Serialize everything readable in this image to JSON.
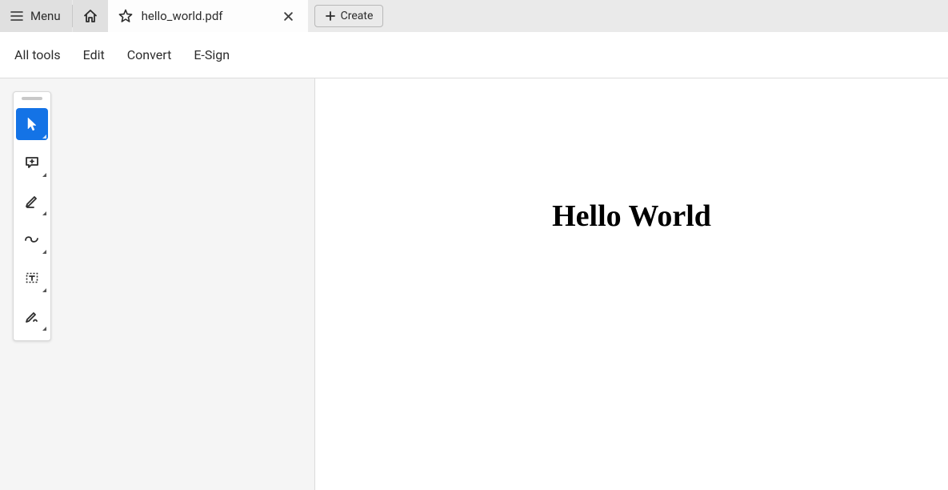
{
  "titlebar": {
    "menu_label": "Menu",
    "tab_title": "hello_world.pdf",
    "create_label": "Create"
  },
  "menubar": {
    "items": [
      "All tools",
      "Edit",
      "Convert",
      "E-Sign"
    ]
  },
  "toolbox": {
    "tools": [
      {
        "name": "select-tool",
        "active": true
      },
      {
        "name": "comment-tool",
        "active": false
      },
      {
        "name": "highlight-tool",
        "active": false
      },
      {
        "name": "draw-tool",
        "active": false
      },
      {
        "name": "textbox-tool",
        "active": false
      },
      {
        "name": "sign-tool",
        "active": false
      }
    ]
  },
  "document": {
    "heading": "Hello World"
  }
}
